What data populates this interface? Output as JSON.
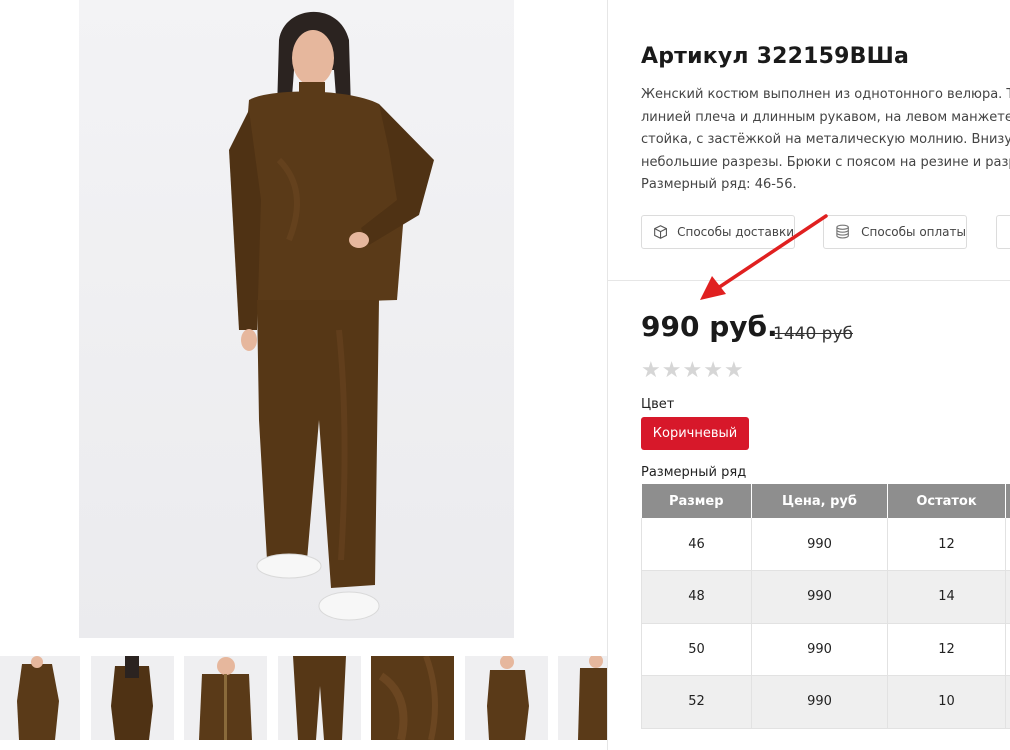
{
  "product": {
    "title": "Артикул 322159ВШа",
    "description": [
      "Женский костюм выполнен из однотонного велюра. Те",
      "линией плеча и длинным рукавом, на левом манжете",
      "стойка, с застёжкой на металическую молнию. Внизу б",
      "небольшие разрезы.  Брюки с поясом на резине и разр",
      "Размерный ряд: 46-56."
    ],
    "price": "990 руб.",
    "old_price": "1440 руб"
  },
  "buttons": {
    "delivery": "Способы доставки",
    "payment": "Способы оплаты",
    "delivery_icon": "box-icon",
    "payment_icon": "coins-icon"
  },
  "rating": {
    "stars": 5,
    "filled": 0
  },
  "color": {
    "label": "Цвет",
    "selected": "Коричневый",
    "swatch": "#d7182a"
  },
  "sizes": {
    "label": "Размерный ряд",
    "headers": [
      "Размер",
      "Цена, руб",
      "Остаток",
      ""
    ],
    "rows": [
      [
        "46",
        "990",
        "12",
        ""
      ],
      [
        "48",
        "990",
        "14",
        ""
      ],
      [
        "50",
        "990",
        "12",
        ""
      ],
      [
        "52",
        "990",
        "10",
        ""
      ]
    ]
  },
  "colors": {
    "accent": "#d7182a",
    "table_header": "#8e8e8e",
    "arrow": "#e02020",
    "fabric": "#5a3a18"
  }
}
